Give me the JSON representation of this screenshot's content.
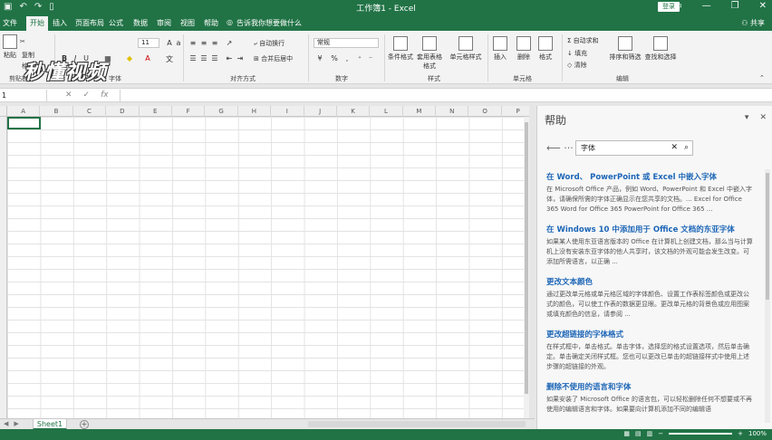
{
  "window": {
    "title": "工作簿1 - Excel",
    "login_label": "登录",
    "qat_icons": [
      "save-icon",
      "undo-icon",
      "redo-icon",
      "new-icon"
    ],
    "min": "—",
    "restore": "❐",
    "close": "✕"
  },
  "watermark": "秒懂视频",
  "tabs": [
    {
      "label": "文件"
    },
    {
      "label": "开始"
    },
    {
      "label": "插入"
    },
    {
      "label": "页面布局"
    },
    {
      "label": "公式"
    },
    {
      "label": "数据"
    },
    {
      "label": "审阅"
    },
    {
      "label": "视图"
    },
    {
      "label": "帮助"
    }
  ],
  "tell_me": "告诉我你想要做什么",
  "share_label": "共享",
  "ribbon": {
    "paste": "粘贴",
    "copy": "复制",
    "format_painter": "格式刷",
    "clipboard": "剪贴板",
    "font_size": "11",
    "font_group": "字体",
    "wrap_text": "自动换行",
    "merge_center": "合并后居中",
    "alignment_group": "对齐方式",
    "number_format": "常规",
    "percent": "%",
    "number_group": "数字",
    "cond_format": "条件格式",
    "table_format": "套用表格格式",
    "cell_style": "单元格样式",
    "styles_group": "样式",
    "insert": "插入",
    "delete": "删除",
    "format": "格式",
    "cells_group": "单元格",
    "autosum": "自动求和",
    "fill": "填充",
    "clear": "清除",
    "sort_filter": "排序和筛选",
    "find_select": "查找和选择",
    "editing_group": "编辑"
  },
  "formula_bar": {
    "name_box": "1",
    "fx": "fx"
  },
  "columns": [
    "A",
    "B",
    "C",
    "D",
    "E",
    "F",
    "G",
    "H",
    "I",
    "J",
    "K",
    "L",
    "M",
    "N",
    "O",
    "P"
  ],
  "sheet": {
    "name": "Sheet1"
  },
  "status": {
    "zoom": "100%"
  },
  "help": {
    "title": "帮助",
    "search_value": "字体",
    "results": [
      {
        "title": "在 Word、 PowerPoint 或 Excel 中嵌入字体",
        "snippet": "在 Microsoft Office 产品，例如 Word、PowerPoint 和 Excel 中嵌入字体，请确保所需的字体正确显示在您共享的文档。... Excel for Office 365 Word for Office 365 PowerPoint for Office 365 ..."
      },
      {
        "title": "在 Windows 10 中添加用于 Office 文档的东亚字体",
        "snippet": "如果某人使用东亚语言版本的 Office 在计算机上创建文档，那么当与计算机上没有安装东亚字体的他人共享时，该文档的外观可能会发生改变。可添加所需语言，以正确 ..."
      },
      {
        "title": "更改文本颜色",
        "snippet": "通过更改单元格或单元格区域的字体颜色、设置工作表标签颜色或更改公式的颜色，可以使工作表的数据更显眼。更改单元格的背景色或应用图案或填充颜色的信息，请参阅 ..."
      },
      {
        "title": "更改超链接的字体格式",
        "snippet": "在样式框中，单击格式。单击字体，选择您的格式设置选项，然后单击确定。单击确定关闭样式框。您也可以更改已单击的超链接样式中使用上述步骤的超链接的外观。"
      },
      {
        "title": "删除不使用的语言和字体",
        "snippet": "如果安装了 Microsoft Office 的语言包，可以轻松删除任何不想要或不再使用的编辑语言和字体。如果要向计算机添加不同的编辑语"
      }
    ]
  }
}
